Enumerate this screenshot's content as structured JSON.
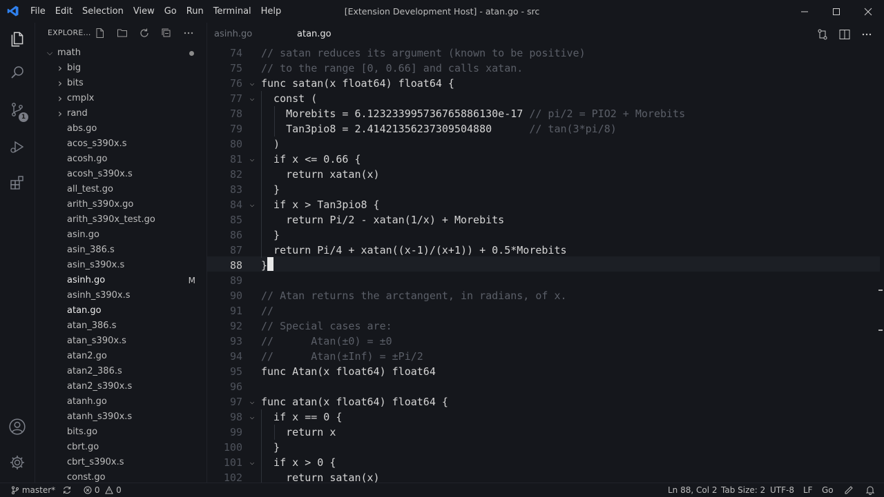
{
  "menu": [
    "File",
    "Edit",
    "Selection",
    "View",
    "Go",
    "Run",
    "Terminal",
    "Help"
  ],
  "window_title": "[Extension Development Host] - atan.go - src",
  "sidebar": {
    "header": "EXPLORE...",
    "folder": "math",
    "items": [
      {
        "label": "big",
        "folder": true
      },
      {
        "label": "bits",
        "folder": true
      },
      {
        "label": "cmplx",
        "folder": true
      },
      {
        "label": "rand",
        "folder": true
      },
      {
        "label": "abs.go"
      },
      {
        "label": "acos_s390x.s"
      },
      {
        "label": "acosh.go"
      },
      {
        "label": "acosh_s390x.s"
      },
      {
        "label": "all_test.go"
      },
      {
        "label": "arith_s390x.go"
      },
      {
        "label": "arith_s390x_test.go"
      },
      {
        "label": "asin.go"
      },
      {
        "label": "asin_386.s"
      },
      {
        "label": "asin_s390x.s"
      },
      {
        "label": "asinh.go",
        "modified": "M",
        "highlight": true
      },
      {
        "label": "asinh_s390x.s"
      },
      {
        "label": "atan.go",
        "highlight": true
      },
      {
        "label": "atan_386.s"
      },
      {
        "label": "atan_s390x.s"
      },
      {
        "label": "atan2.go"
      },
      {
        "label": "atan2_386.s"
      },
      {
        "label": "atan2_s390x.s"
      },
      {
        "label": "atanh.go"
      },
      {
        "label": "atanh_s390x.s"
      },
      {
        "label": "bits.go"
      },
      {
        "label": "cbrt.go"
      },
      {
        "label": "cbrt_s390x.s"
      },
      {
        "label": "const.go"
      }
    ]
  },
  "activity": {
    "scm_badge": "1"
  },
  "tabs": [
    {
      "label": "asinh.go",
      "active": false
    },
    {
      "label": "atan.go",
      "active": true
    }
  ],
  "editor": {
    "lines": [
      {
        "n": "74",
        "text": "// satan reduces its argument (known to be positive)",
        "comment": true
      },
      {
        "n": "75",
        "text": "// to the range [0, 0.66] and calls xatan.",
        "comment": true
      },
      {
        "n": "76",
        "text": "func satan(x float64) float64 {",
        "fold": true
      },
      {
        "n": "77",
        "text": "  const (",
        "fold": true
      },
      {
        "n": "78",
        "text": "    Morebits = 6.123233995736765886130e-17",
        "trail": " // pi/2 = PIO2 + Morebits"
      },
      {
        "n": "79",
        "text": "    Tan3pio8 = 2.41421356237309504880",
        "trail": "      // tan(3*pi/8)"
      },
      {
        "n": "80",
        "text": "  )"
      },
      {
        "n": "81",
        "text": "  if x <= 0.66 {",
        "fold": true
      },
      {
        "n": "82",
        "text": "    return xatan(x)"
      },
      {
        "n": "83",
        "text": "  }"
      },
      {
        "n": "84",
        "text": "  if x > Tan3pio8 {",
        "fold": true
      },
      {
        "n": "85",
        "text": "    return Pi/2 - xatan(1/x) + Morebits"
      },
      {
        "n": "86",
        "text": "  }"
      },
      {
        "n": "87",
        "text": "  return Pi/4 + xatan((x-1)/(x+1)) + 0.5*Morebits"
      },
      {
        "n": "88",
        "text": "}",
        "active": true
      },
      {
        "n": "89",
        "text": ""
      },
      {
        "n": "90",
        "text": "// Atan returns the arctangent, in radians, of x.",
        "comment": true
      },
      {
        "n": "91",
        "text": "//",
        "comment": true
      },
      {
        "n": "92",
        "text": "// Special cases are:",
        "comment": true
      },
      {
        "n": "93",
        "text": "//      Atan(±0) = ±0",
        "comment": true
      },
      {
        "n": "94",
        "text": "//      Atan(±Inf) = ±Pi/2",
        "comment": true
      },
      {
        "n": "95",
        "text": "func Atan(x float64) float64"
      },
      {
        "n": "96",
        "text": ""
      },
      {
        "n": "97",
        "text": "func atan(x float64) float64 {",
        "fold": true
      },
      {
        "n": "98",
        "text": "  if x == 0 {",
        "fold": true
      },
      {
        "n": "99",
        "text": "    return x"
      },
      {
        "n": "100",
        "text": "  }"
      },
      {
        "n": "101",
        "text": "  if x > 0 {",
        "fold": true
      },
      {
        "n": "102",
        "text": "    return satan(x)"
      }
    ]
  },
  "status": {
    "branch": "master*",
    "errors": "0",
    "warnings": "0",
    "position": "Ln 88, Col 2",
    "tab_size": "Tab Size: 2",
    "encoding": "UTF-8",
    "eol": "LF",
    "language": "Go"
  },
  "colors": {
    "background": "#15171c",
    "accent": "#2f80ed"
  }
}
